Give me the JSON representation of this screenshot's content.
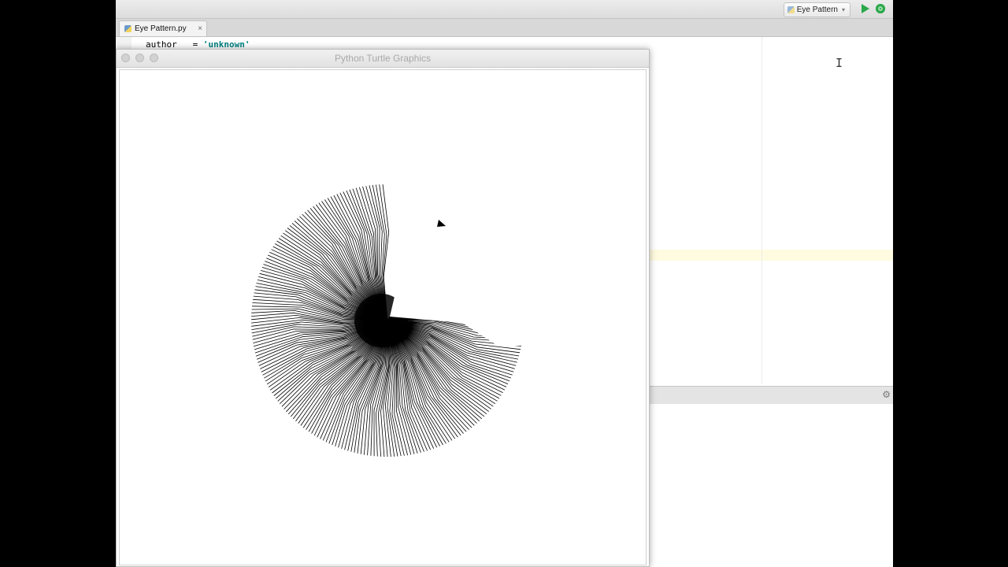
{
  "toolbar": {
    "run_config": "Eye Pattern",
    "run_icon": "run-icon",
    "debug_icon": "debug-icon"
  },
  "tabs": [
    {
      "label": "Eye Pattern.py",
      "close": "×",
      "active": true
    }
  ],
  "editor": {
    "code_line_1": {
      "identifier": "author",
      "operator": "=",
      "string": "'unknown'"
    }
  },
  "turtle_window": {
    "title": "Python Turtle Graphics"
  },
  "colors": {
    "run_green": "#2aa84a",
    "string_teal": "#008080",
    "current_line_highlight": "#fffbe0"
  }
}
